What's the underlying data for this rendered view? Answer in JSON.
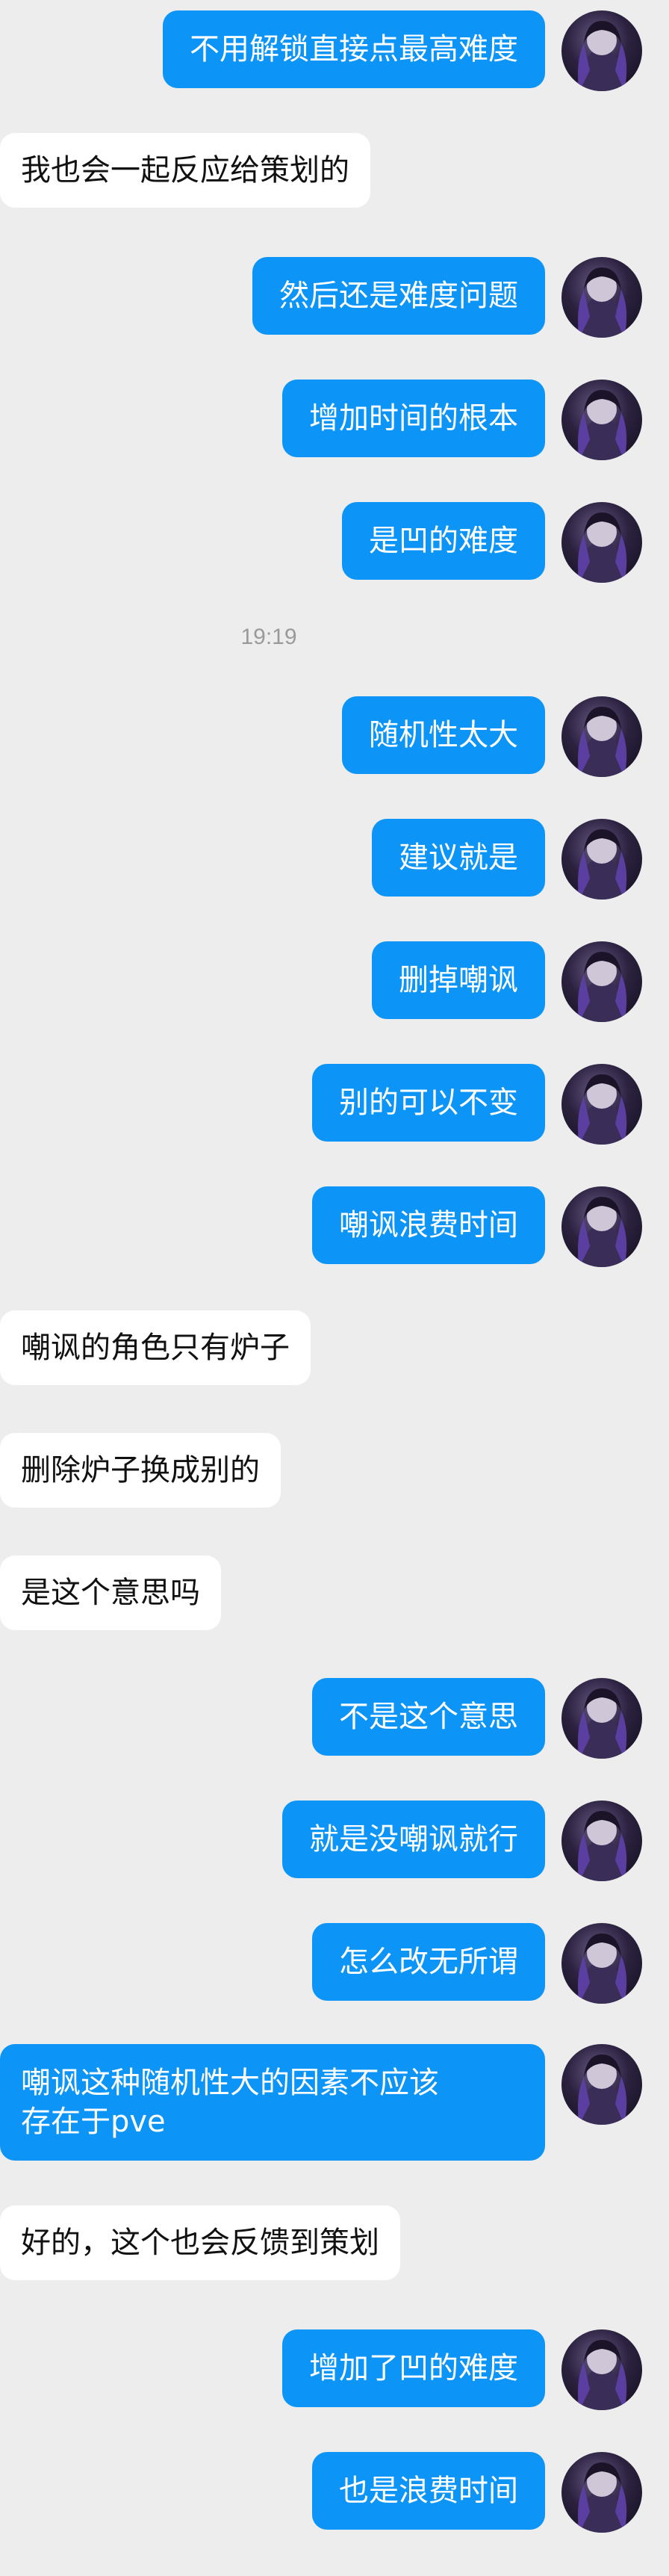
{
  "conversation": {
    "messages": [
      {
        "side": "out",
        "text": "不用解锁直接点最高难度"
      },
      {
        "side": "in",
        "text": "我也会一起反应给策划的"
      },
      {
        "side": "out",
        "text": "然后还是难度问题"
      },
      {
        "side": "out",
        "text": "增加时间的根本"
      },
      {
        "side": "out",
        "text": "是凹的难度"
      },
      {
        "side": "out",
        "text": "随机性太大"
      },
      {
        "side": "out",
        "text": "建议就是"
      },
      {
        "side": "out",
        "text": "删掉嘲讽"
      },
      {
        "side": "out",
        "text": "别的可以不变"
      },
      {
        "side": "out",
        "text": "嘲讽浪费时间"
      },
      {
        "side": "in",
        "text": "嘲讽的角色只有炉子"
      },
      {
        "side": "in",
        "text": "删除炉子换成别的"
      },
      {
        "side": "in",
        "text": "是这个意思吗"
      },
      {
        "side": "out",
        "text": "不是这个意思"
      },
      {
        "side": "out",
        "text": "就是没嘲讽就行"
      },
      {
        "side": "out",
        "text": "怎么改无所谓"
      },
      {
        "side": "out",
        "text": "嘲讽这种随机性大的因素不应该\n存在于pve"
      },
      {
        "side": "in",
        "text": "好的，这个也会反馈到策划"
      },
      {
        "side": "out",
        "text": "增加了凹的难度"
      },
      {
        "side": "out",
        "text": "也是浪费时间"
      }
    ],
    "timestamp": "19:19"
  },
  "theme": {
    "outgoing_bubble": "#0d94f7",
    "incoming_bubble": "#ffffff",
    "background": "#ededed"
  },
  "avatar_icon": "user-avatar-icon"
}
